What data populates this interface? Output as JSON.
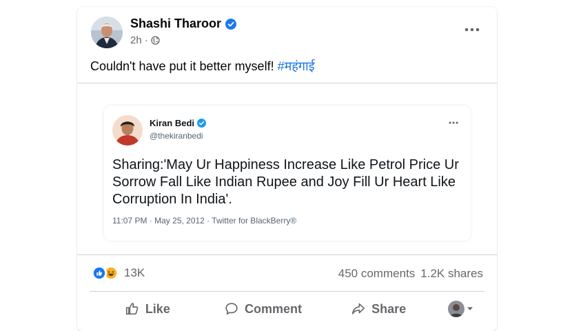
{
  "post": {
    "author": "Shashi Tharoor",
    "time": "2h",
    "text": "Couldn't have put it better myself! ",
    "hashtag": "#महंगाई"
  },
  "tweet": {
    "name": "Kiran Bedi",
    "handle": "@thekiranbedi",
    "body": "Sharing:'May Ur Happiness Increase Like Petrol Price Ur Sorrow Fall Like Indian Rupee and Joy Fill Ur Heart Like Corruption In India'.",
    "meta": "11:07 PM · May 25, 2012 · Twitter for BlackBerry®"
  },
  "stats": {
    "reactions_count": "13K",
    "comments": "450 comments",
    "shares": "1.2K shares"
  },
  "actions": {
    "like": "Like",
    "comment": "Comment",
    "share": "Share"
  },
  "icons": {
    "verified": "verified-badge-icon",
    "globe": "globe-icon",
    "more": "more-options-icon",
    "like_reaction": "like-reaction-icon",
    "haha_reaction": "haha-reaction-icon",
    "thumb": "thumbs-up-icon",
    "comment": "comment-bubble-icon",
    "share": "share-arrow-icon",
    "caret": "caret-down-icon"
  },
  "colors": {
    "brand_blue": "#1877f2",
    "hashtag": "#1b74e4",
    "secondary_text": "#65676b",
    "haha_yellow": "#f7b125"
  }
}
